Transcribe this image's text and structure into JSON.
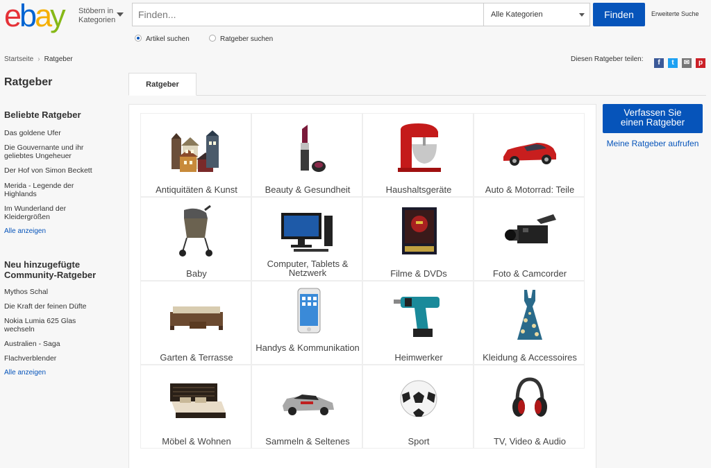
{
  "header": {
    "logo_letters": [
      "e",
      "b",
      "a",
      "y"
    ],
    "logo_colors": [
      "#e53238",
      "#0064d2",
      "#f5af02",
      "#86b817"
    ],
    "browse_line1": "Stöbern in",
    "browse_line2": "Kategorien",
    "search_placeholder": "Finden...",
    "category_selected": "Alle Kategorien",
    "find_label": "Finden",
    "advanced_search": "Erweiterte Suche",
    "radio_items": "Artikel suchen",
    "radio_guides": "Ratgeber suchen"
  },
  "breadcrumb": {
    "home": "Startseite",
    "current": "Ratgeber"
  },
  "share": {
    "label": "Diesen Ratgeber teilen:",
    "icons": [
      "facebook-icon",
      "twitter-icon",
      "email-icon",
      "pinterest-icon"
    ],
    "colors": [
      "#3b5998",
      "#1da1f2",
      "#777777",
      "#cb2027"
    ]
  },
  "sidebar": {
    "title": "Ratgeber",
    "popular_title": "Beliebte Ratgeber",
    "popular": [
      "Das goldene Ufer",
      "Die Gouvernante und ihr geliebtes Ungeheuer",
      "Der Hof von Simon Beckett",
      "Merida - Legende der Highlands",
      "Im Wunderland der Kleidergrößen"
    ],
    "popular_show_all": "Alle anzeigen",
    "new_title": "Neu hinzugefügte Community-Ratgeber",
    "new": [
      "Mythos Schal",
      "Die Kraft der feinen Düfte",
      "Nokia Lumia 625 Glas wechseln",
      "Australien - Saga",
      "Flachverblender"
    ],
    "new_show_all": "Alle anzeigen"
  },
  "tab": {
    "label": "Ratgeber"
  },
  "categories": [
    {
      "label": "Antiquitäten & Kunst",
      "icon": "houses-art-icon"
    },
    {
      "label": "Beauty & Gesundheit",
      "icon": "lipstick-icon"
    },
    {
      "label": "Haushaltsgeräte",
      "icon": "stand-mixer-icon"
    },
    {
      "label": "Auto & Motorrad: Teile",
      "icon": "red-car-icon"
    },
    {
      "label": "Baby",
      "icon": "stroller-icon"
    },
    {
      "label": "Computer, Tablets & Netzwerk",
      "icon": "computer-icon"
    },
    {
      "label": "Filme & DVDs",
      "icon": "dvd-box-icon"
    },
    {
      "label": "Foto & Camcorder",
      "icon": "camcorder-icon"
    },
    {
      "label": "Garten & Terrasse",
      "icon": "patio-furniture-icon"
    },
    {
      "label": "Handys & Kommunikation",
      "icon": "smartphone-icon"
    },
    {
      "label": "Heimwerker",
      "icon": "drill-icon"
    },
    {
      "label": "Kleidung & Accessoires",
      "icon": "dress-icon"
    },
    {
      "label": "Möbel & Wohnen",
      "icon": "bed-icon"
    },
    {
      "label": "Sammeln & Seltenes",
      "icon": "toy-car-icon"
    },
    {
      "label": "Sport",
      "icon": "soccer-ball-icon"
    },
    {
      "label": "TV, Video & Audio",
      "icon": "headphones-icon"
    }
  ],
  "right": {
    "write_label_1": "Verfassen Sie",
    "write_label_2": "einen Ratgeber",
    "my_guides": "Meine Ratgeber aufrufen"
  }
}
